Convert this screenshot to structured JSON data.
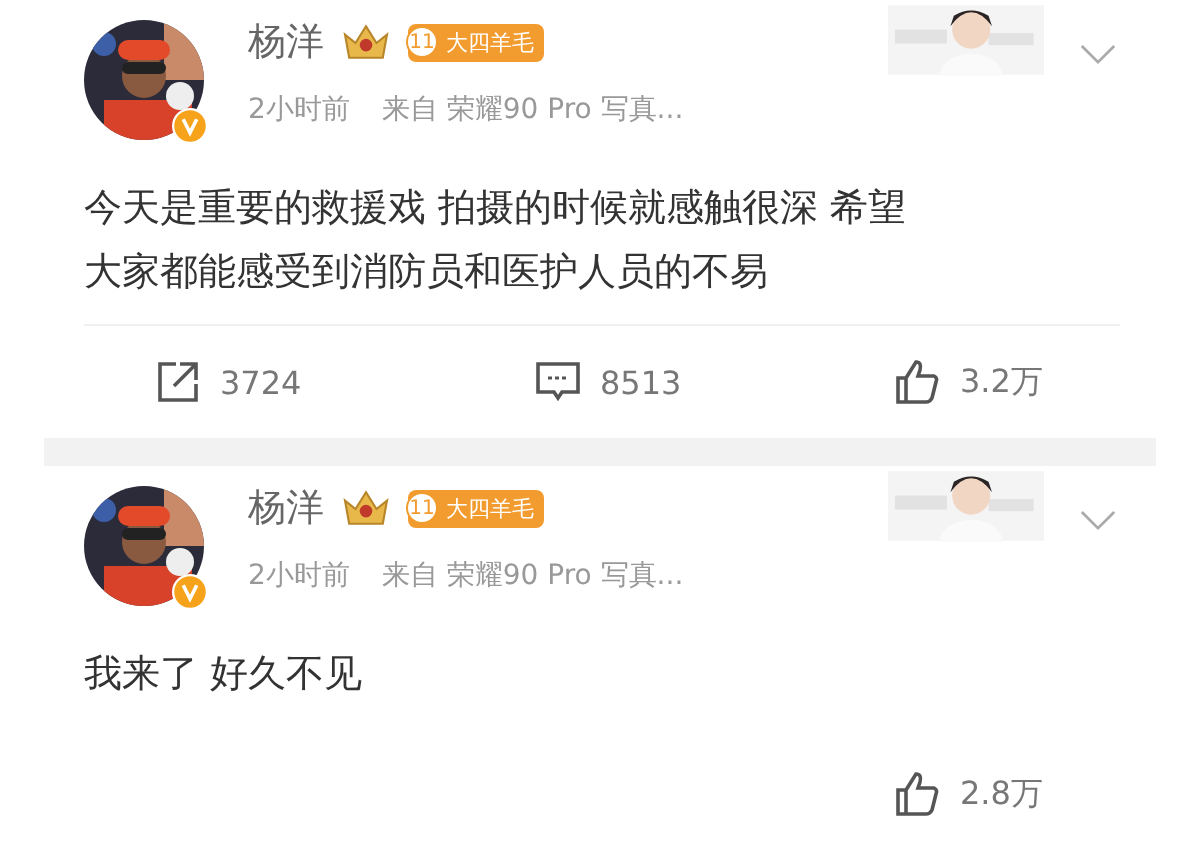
{
  "posts": [
    {
      "author": "杨洋",
      "verified": true,
      "badge": {
        "level": "11",
        "name": "大四羊毛"
      },
      "time": "2小时前",
      "source": "来自 荣耀90 Pro 写真...",
      "text_lines": [
        "今天是重要的救援戏 拍摄的时候就感触很深 希望",
        "大家都能感受到消防员和医护人员的不易"
      ],
      "stats": [
        {
          "kind": "repost",
          "count": "3724"
        },
        {
          "kind": "comment",
          "count": "8513"
        },
        {
          "kind": "like",
          "count": "3.2万"
        }
      ]
    },
    {
      "author": "杨洋",
      "verified": true,
      "badge": {
        "level": "11",
        "name": "大四羊毛"
      },
      "time": "2小时前",
      "source": "来自 荣耀90 Pro 写真...",
      "text_lines": [
        "我来了 好久不见"
      ],
      "stats": [
        {
          "kind": "like",
          "count": "2.8万"
        }
      ]
    }
  ]
}
